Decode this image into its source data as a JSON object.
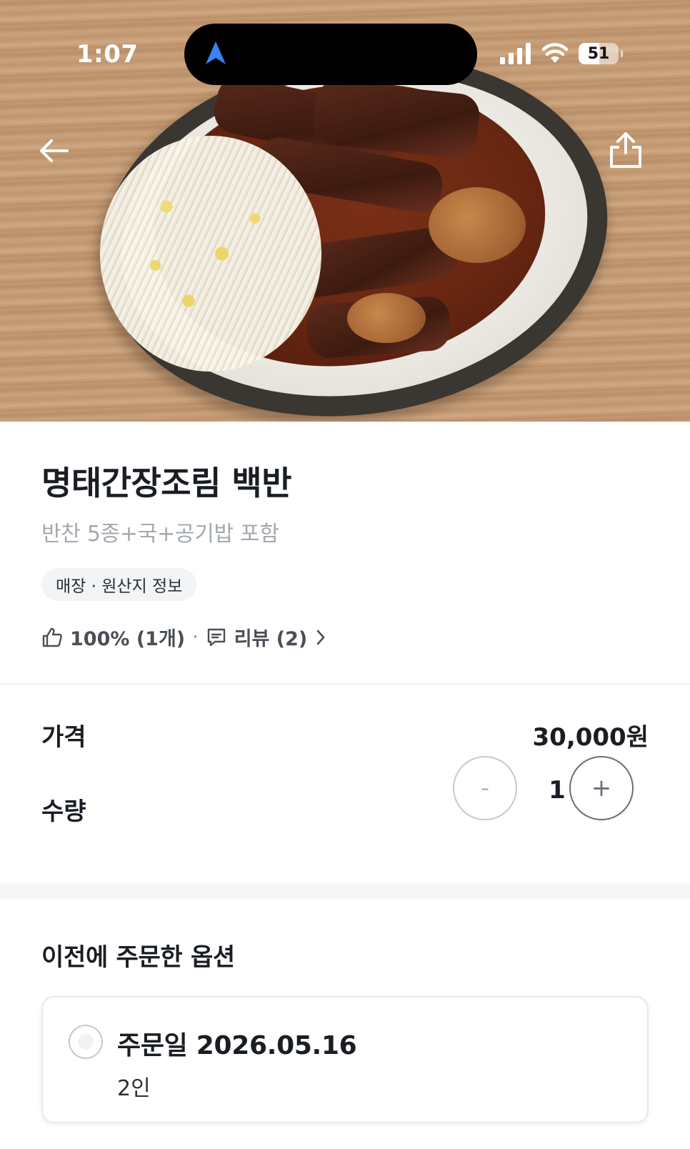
{
  "status_bar": {
    "time": "1:07",
    "battery_level": "51",
    "icons": [
      "location-arrow-icon",
      "signal-icon",
      "wifi-icon",
      "battery-icon"
    ]
  },
  "hero": {
    "image_alt": "명태간장조림 백반",
    "back_icon": "back-arrow-icon",
    "share_icon": "share-icon"
  },
  "product": {
    "title": "명태간장조림 백반",
    "subtitle": "반찬 5종+국+공기밥 포함",
    "info_chip": "매장 · 원산지 정보",
    "rating": "100% (1개)",
    "separator": "·",
    "reviews": "리뷰 (2)"
  },
  "price": {
    "label": "가격",
    "value": "30,000원"
  },
  "quantity": {
    "label": "수량",
    "value": "1",
    "minus": "-",
    "plus": "+"
  },
  "previous_options": {
    "title": "이전에 주문한 옵션",
    "items": [
      {
        "date": "주문일 2026.05.16",
        "desc": "2인",
        "selected": false
      }
    ]
  },
  "colors": {
    "text_primary": "#1a1e24",
    "text_secondary": "#a3a8b0",
    "chip_bg": "#f3f4f6",
    "divider": "#f5f6f8",
    "status_nav_blue": "#3b82f6"
  }
}
